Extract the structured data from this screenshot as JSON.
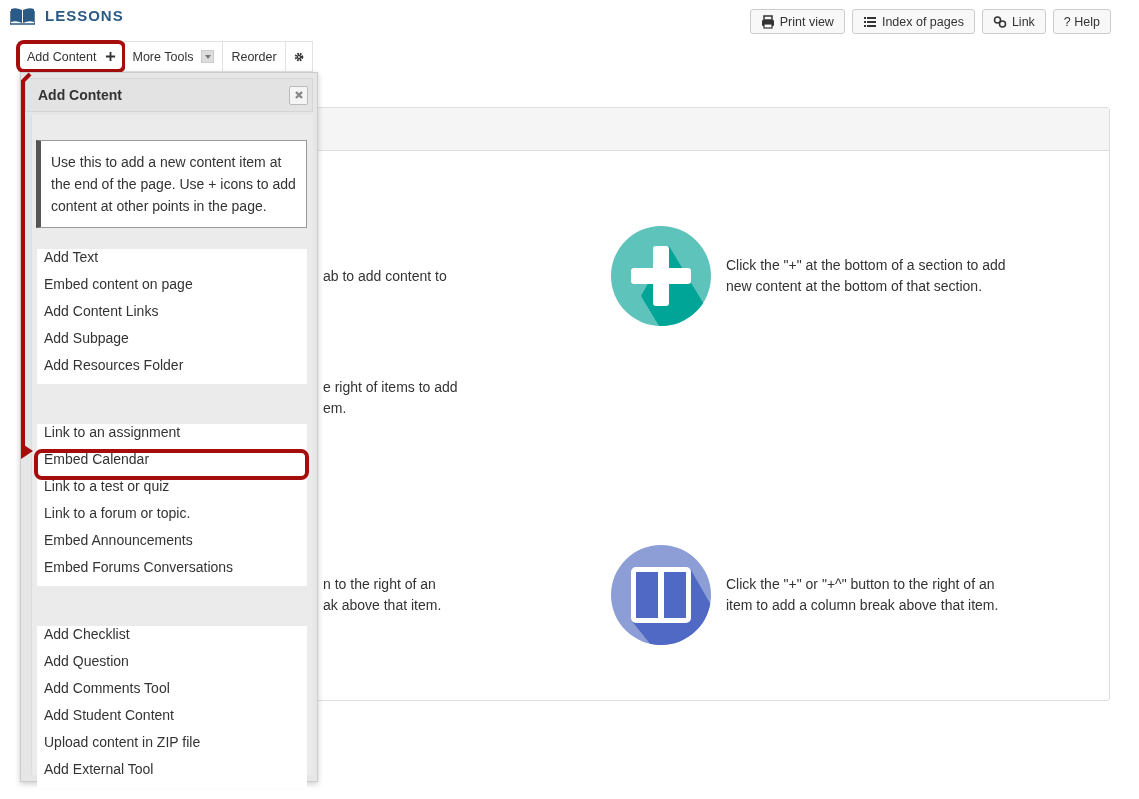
{
  "header": {
    "title": "LESSONS"
  },
  "header_buttons": [
    {
      "kind": "print",
      "label": "Print view"
    },
    {
      "kind": "list",
      "label": "Index of pages"
    },
    {
      "kind": "link",
      "label": "Link"
    },
    {
      "kind": "help",
      "label": "? Help"
    }
  ],
  "toolbar": [
    {
      "kind": "add",
      "label": "Add Content",
      "highlighted": true
    },
    {
      "kind": "dropdown",
      "label": "More Tools",
      "highlighted": false
    },
    {
      "kind": "plain",
      "label": "Reorder",
      "highlighted": false
    },
    {
      "kind": "settings",
      "highlighted": false
    }
  ],
  "popup": {
    "title": "Add Content",
    "info": "Use this to add a new content item at the end of the page. Use + icons to add content at other points in the page.",
    "groups": [
      [
        {
          "label": "Add Text",
          "highlighted": false
        },
        {
          "label": "Embed content on page",
          "highlighted": false
        },
        {
          "label": "Add Content Links",
          "highlighted": false
        },
        {
          "label": "Add Subpage",
          "highlighted": false
        },
        {
          "label": "Add Resources Folder",
          "highlighted": false
        }
      ],
      [
        {
          "label": "Link to an assignment",
          "highlighted": false
        },
        {
          "label": "Embed Calendar",
          "highlighted": true
        },
        {
          "label": "Link to a test or quiz",
          "highlighted": false
        },
        {
          "label": "Link to a forum or topic.",
          "highlighted": false
        },
        {
          "label": "Embed Announcements",
          "highlighted": false
        },
        {
          "label": "Embed Forums Conversations",
          "highlighted": false
        }
      ],
      [
        {
          "label": "Add Checklist",
          "highlighted": false
        },
        {
          "label": "Add Question",
          "highlighted": false
        },
        {
          "label": "Add Comments Tool",
          "highlighted": false
        },
        {
          "label": "Add Student Content",
          "highlighted": false
        },
        {
          "label": "Upload content in ZIP file",
          "highlighted": false
        },
        {
          "label": "Add External Tool",
          "highlighted": false
        }
      ]
    ]
  },
  "panel": {
    "rows": [
      {
        "left_lines": [
          "ab to add content to"
        ],
        "kind": "plus",
        "right_lines": [
          "Click the \"+\" at the bottom of a section to add",
          "new content at the bottom of that section."
        ]
      },
      {
        "left_lines": [
          "e right of items to add",
          "em."
        ],
        "kind": "text"
      },
      {
        "left_lines": [
          "n to the right of an",
          "ak above that item."
        ],
        "kind": "columns",
        "right_lines": [
          "Click the \"+\" or \"+^\" button to the right of an",
          "item to add a column break above that item."
        ]
      }
    ]
  }
}
